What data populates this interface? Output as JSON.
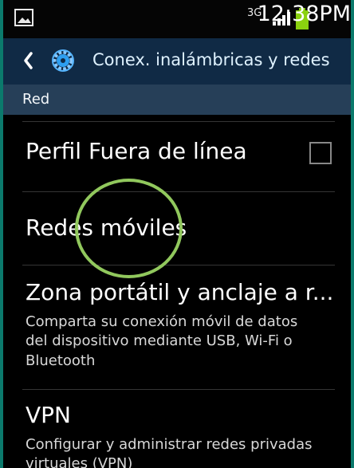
{
  "status_bar": {
    "network": "3G",
    "time": "12:38PM"
  },
  "header": {
    "title": "Conex. inalámbricas y redes"
  },
  "section": {
    "title": "Red"
  },
  "items": [
    {
      "title": "Perfil Fuera de línea",
      "summary": ""
    },
    {
      "title": "Redes móviles",
      "summary": ""
    },
    {
      "title": "Zona portátil y anclaje a r...",
      "summary": "Comparta su conexión móvil de datos del dispositivo mediante USB, Wi-Fi o Bluetooth"
    },
    {
      "title": "VPN",
      "summary": "Configurar y administrar redes privadas virtuales (VPN)"
    }
  ],
  "colors": {
    "action_bar": "#102a45",
    "section_header": "#263f58",
    "accent": "#91c85d",
    "frame": "#0b7a6c",
    "battery": "#8ad10f"
  },
  "icons": {
    "status_left": "image-icon",
    "signal": "signal-icon",
    "battery": "battery-icon",
    "back": "back-icon",
    "settings": "settings-icon"
  }
}
